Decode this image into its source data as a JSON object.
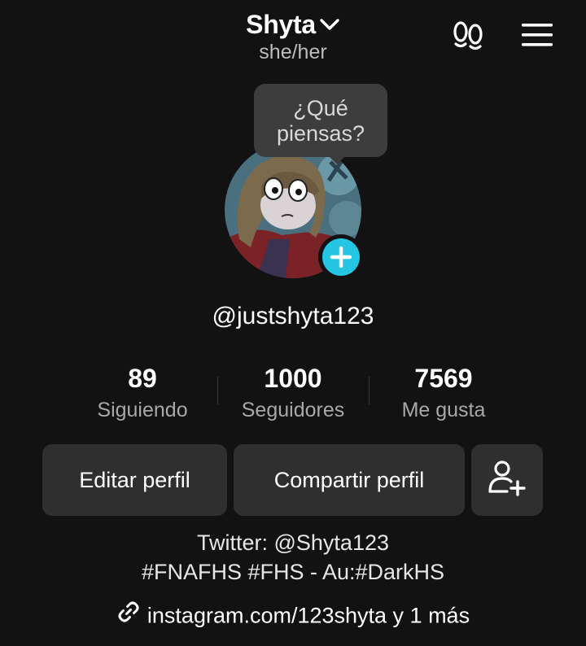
{
  "header": {
    "display_name": "Shyta",
    "pronouns": "she/her",
    "icons": {
      "name_dropdown": "chevron-down-icon",
      "profile_views": "footprints-icon",
      "menu": "hamburger-menu-icon"
    }
  },
  "note_bubble": {
    "line1": "¿Qué",
    "line2": "piensas?"
  },
  "avatar": {
    "add_icon": "plus-icon",
    "add_color": "#25c5e4"
  },
  "profile": {
    "username": "@justshyta123"
  },
  "stats": [
    {
      "value": "89",
      "label": "Siguiendo"
    },
    {
      "value": "1000",
      "label": "Seguidores"
    },
    {
      "value": "7569",
      "label": "Me gusta"
    }
  ],
  "actions": {
    "edit_label": "Editar perfil",
    "share_label": "Compartir perfil",
    "add_friend_icon": "add-user-icon"
  },
  "bio": {
    "line1": "Twitter: @Shyta123",
    "line2": "#FNAFHS #FHS - Au:#DarkHS"
  },
  "link": {
    "icon": "link-icon",
    "text": "instagram.com/123shyta y 1 más"
  }
}
